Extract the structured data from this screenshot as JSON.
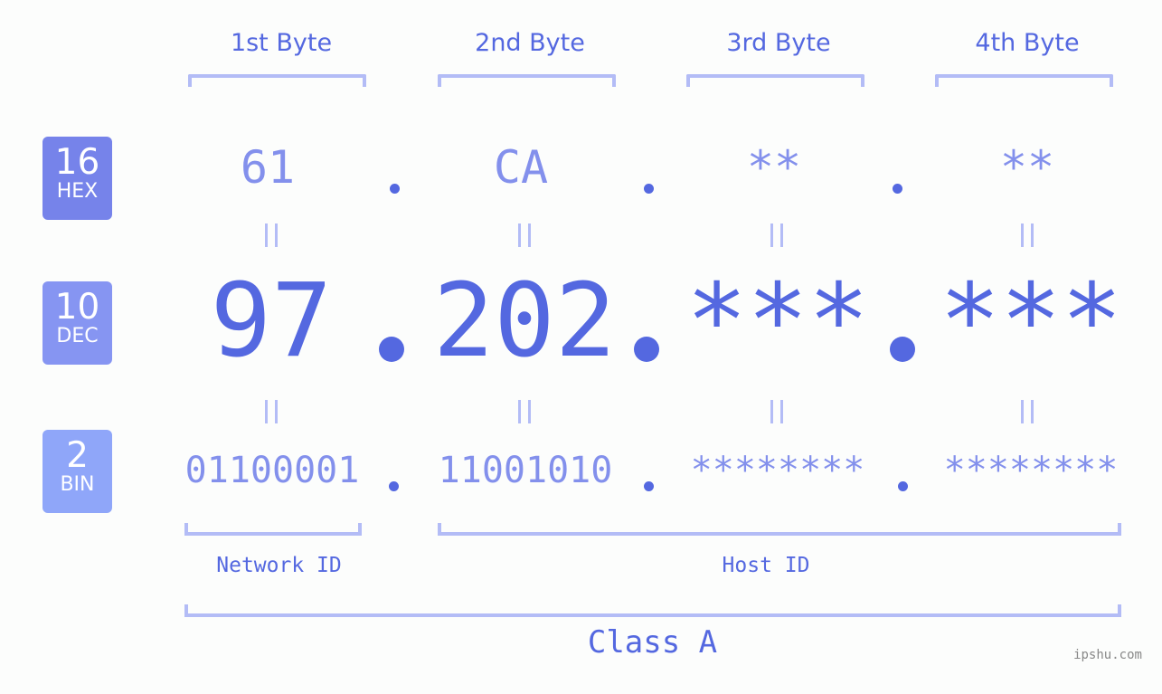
{
  "headers": [
    "1st Byte",
    "2nd Byte",
    "3rd Byte",
    "4th Byte"
  ],
  "badges": {
    "hex": {
      "num": "16",
      "label": "HEX"
    },
    "dec": {
      "num": "10",
      "label": "DEC"
    },
    "bin": {
      "num": "2",
      "label": "BIN"
    }
  },
  "hex": [
    "61",
    "CA",
    "**",
    "**"
  ],
  "dec": [
    "97",
    "202",
    "***",
    "***"
  ],
  "bin": [
    "01100001",
    "11001010",
    "********",
    "********"
  ],
  "labels": {
    "network_id": "Network ID",
    "host_id": "Host ID",
    "class": "Class A"
  },
  "watermark": "ipshu.com",
  "colors": {
    "accent": "#5468e0",
    "light_accent": "#8390ec",
    "bracket": "#b3bcf6",
    "hex_badge": "#7683ea",
    "dec_badge": "#8695f2",
    "bin_badge": "#8fa6f9"
  }
}
